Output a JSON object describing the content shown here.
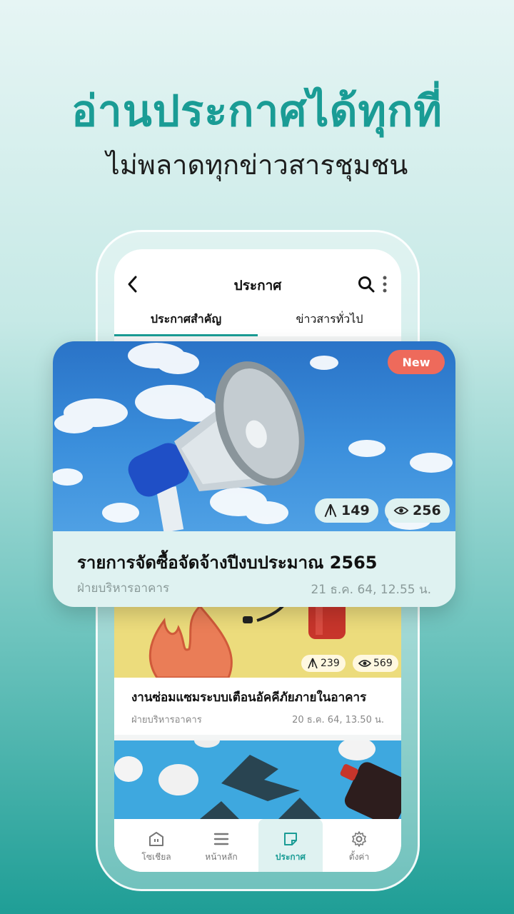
{
  "promo": {
    "headline": "อ่านประกาศได้ทุกที่",
    "subline": "ไม่พลาดทุกข่าวสารชุมชน"
  },
  "screen": {
    "title": "ประกาศ",
    "icons": {
      "back": "back-chevron-icon",
      "search": "search-icon",
      "more": "more-vertical-icon"
    },
    "tabs": [
      {
        "label": "ประกาศสำคัญ",
        "active": true
      },
      {
        "label": "ข่าวสารทั่วไป",
        "active": false
      }
    ],
    "accent_color": "#1a9c95"
  },
  "featured": {
    "badge": "New",
    "badge_color": "#ee6a5b",
    "acknowledge_count": "149",
    "view_count": "256",
    "title": "รายการจัดซื้อจัดจ้างปีงบประมาณ 2565",
    "author": "ฝ่ายบริหารอาคาร",
    "date": "21 ธ.ค. 64, 12.55 น."
  },
  "second": {
    "acknowledge_count": "239",
    "view_count": "569",
    "title": "งานซ่อมแซมระบบเตือนอัคคีภัยภายในอาคาร",
    "author": "ฝ่ายบริหารอาคาร",
    "date": "20 ธ.ค. 64, 13.50 น."
  },
  "nav": [
    {
      "label": "โซเชียล",
      "icon": "social-icon",
      "active": false
    },
    {
      "label": "หน้าหลัก",
      "icon": "menu-icon",
      "active": false
    },
    {
      "label": "ประกาศ",
      "icon": "announcement-icon",
      "active": true
    },
    {
      "label": "ตั้งค่า",
      "icon": "gear-icon",
      "active": false
    }
  ]
}
